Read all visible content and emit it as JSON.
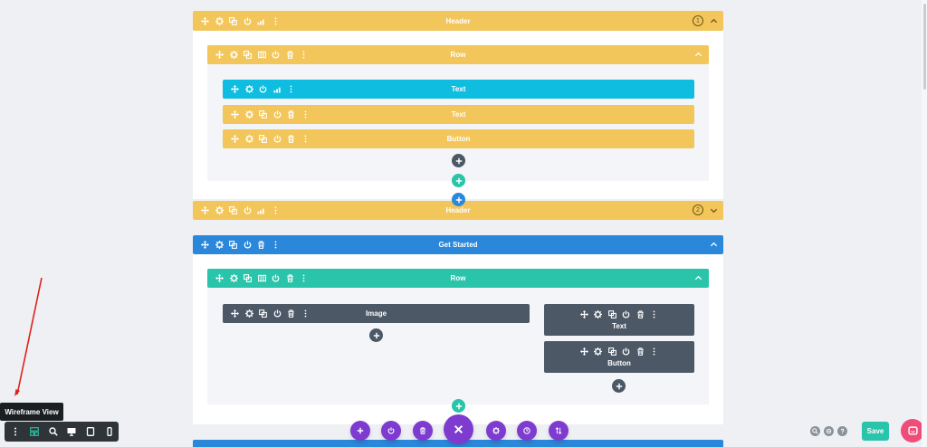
{
  "colors": {
    "section_header": "#f2c65a",
    "section_blue": "#2b87da",
    "row_green": "#29c4a9",
    "module_cyan": "#0ebde0",
    "module_dark": "#4c5866",
    "purple": "#7e3bd0",
    "save": "#29c4a9"
  },
  "sections": {
    "header1": {
      "title": "Header",
      "badge": "1"
    },
    "header2": {
      "title": "Header",
      "badge": "2"
    },
    "getstarted": {
      "title": "Get Started"
    }
  },
  "rows": {
    "row1": {
      "title": "Row"
    },
    "row2": {
      "title": "Row"
    }
  },
  "modules": {
    "text_active": {
      "title": "Text"
    },
    "text2": {
      "title": "Text"
    },
    "button1": {
      "title": "Button"
    },
    "image": {
      "title": "Image"
    },
    "text3": {
      "title": "Text"
    },
    "button2": {
      "title": "Button"
    }
  },
  "bottom_toolbar": {
    "tooltip": "Wireframe View",
    "items": [
      "menu-icon",
      "wireframe-icon",
      "zoom-icon",
      "desktop-icon",
      "tablet-icon",
      "phone-icon"
    ]
  },
  "actions": {
    "save_label": "Save"
  }
}
